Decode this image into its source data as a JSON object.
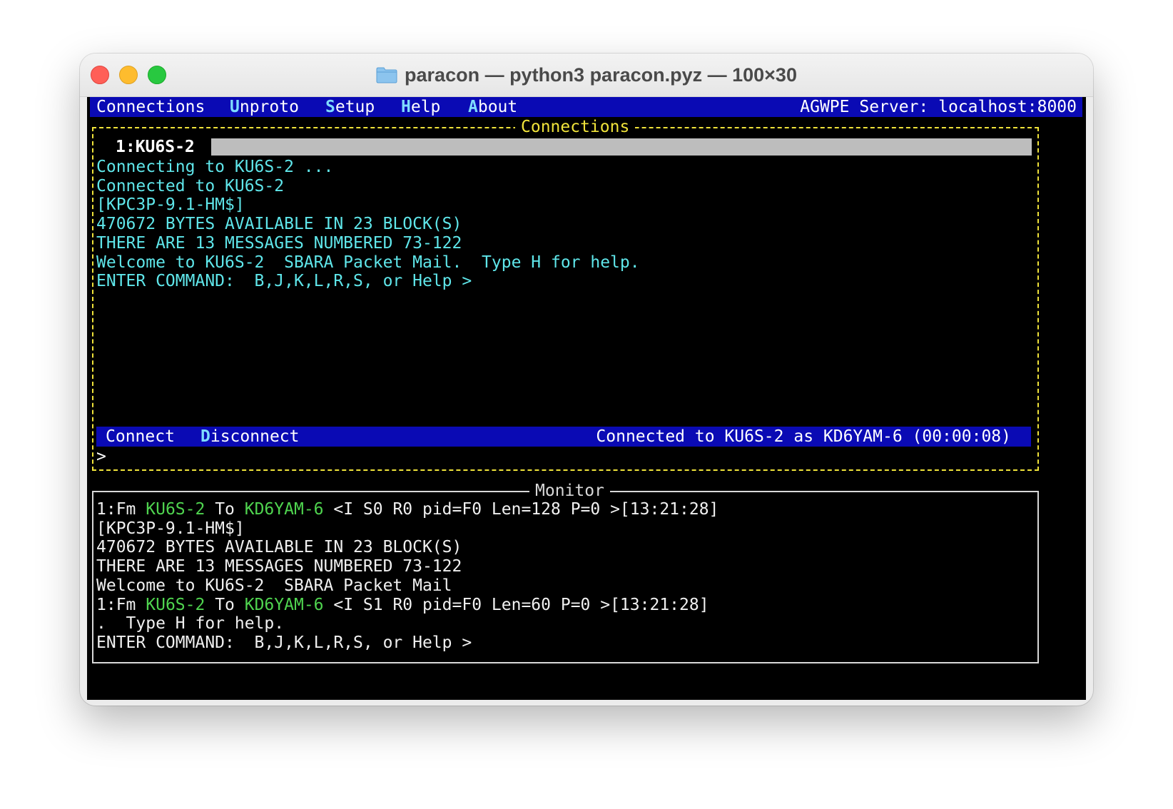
{
  "window": {
    "title": "paracon — python3 paracon.pyz — 100×30"
  },
  "menu": {
    "items": [
      {
        "hot": "",
        "rest": "Connections"
      },
      {
        "hot": "U",
        "rest": "nproto"
      },
      {
        "hot": "S",
        "rest": "etup"
      },
      {
        "hot": "H",
        "rest": "elp"
      },
      {
        "hot": "A",
        "rest": "bout"
      }
    ],
    "server": "AGWPE Server: localhost:8000"
  },
  "connections": {
    "panel_title": "Connections",
    "tab": "1:KU6S-2",
    "lines": [
      "Connecting to KU6S-2 ...",
      "Connected to KU6S-2",
      "[KPC3P-9.1-HM$]",
      "470672 BYTES AVAILABLE IN 23 BLOCK(S)",
      "THERE ARE 13 MESSAGES NUMBERED 73-122",
      "Welcome to KU6S-2  SBARA Packet Mail.  Type H for help.",
      "ENTER COMMAND:  B,J,K,L,R,S, or Help >"
    ],
    "commands": [
      {
        "hot": "",
        "rest": "Connect"
      },
      {
        "hot": "D",
        "rest": "isconnect"
      }
    ],
    "status": "Connected to KU6S-2 as KD6YAM-6 (00:00:08)",
    "prompt": ">"
  },
  "monitor": {
    "panel_title": "Monitor",
    "header1": {
      "prefix": "1:Fm ",
      "from": "KU6S-2",
      "to_word": " To ",
      "to": "KD6YAM-6",
      "info": " <I S0 R0 pid=F0 Len=128 P=0 >[13:21:28]"
    },
    "lines_a": [
      "[KPC3P-9.1-HM$]",
      "470672 BYTES AVAILABLE IN 23 BLOCK(S)",
      "THERE ARE 13 MESSAGES NUMBERED 73-122",
      "Welcome to KU6S-2  SBARA Packet Mail"
    ],
    "header2": {
      "prefix": "1:Fm ",
      "from": "KU6S-2",
      "to_word": " To ",
      "to": "KD6YAM-6",
      "info": " <I S1 R0 pid=F0 Len=60 P=0 >[13:21:28]"
    },
    "lines_b": [
      ".  Type H for help.",
      "ENTER COMMAND:  B,J,K,L,R,S, or Help >"
    ]
  },
  "colors": {
    "bar": "#0a0ab4",
    "conn_border": "#f0e33a",
    "cyan_text": "#5fe6ea",
    "callsign": "#4fd44f"
  }
}
